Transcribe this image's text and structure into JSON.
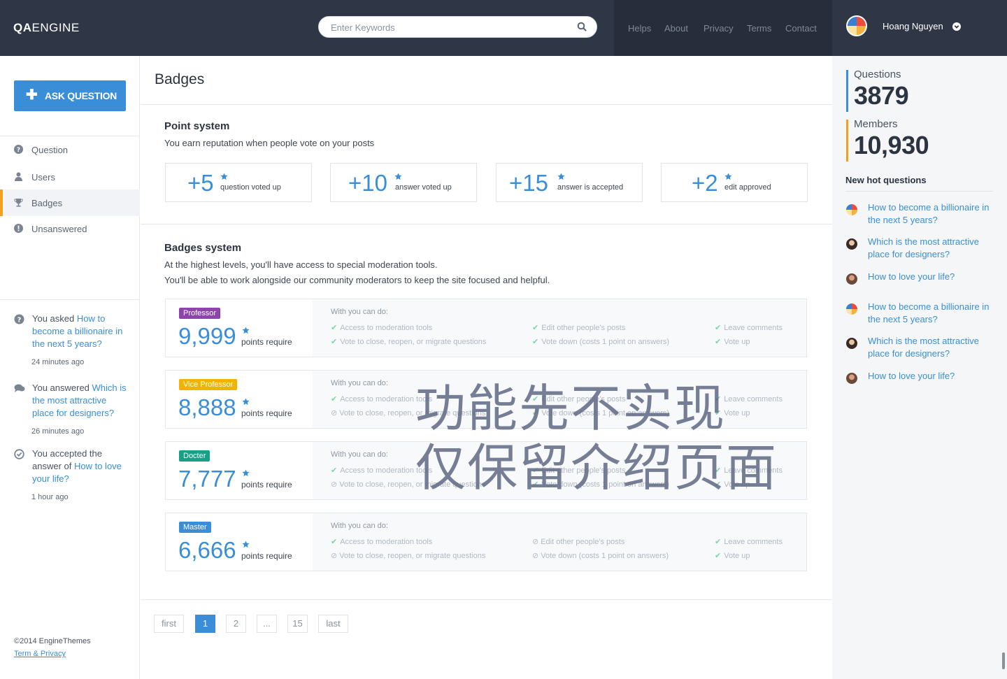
{
  "header": {
    "logo_bold": "QA",
    "logo_rest": "ENGINE",
    "search_placeholder": "Enter Keywords",
    "nav": [
      "Helps",
      "About",
      "Privacy",
      "Terms",
      "Contact"
    ],
    "user_name": "Hoang Nguyen"
  },
  "sidebar": {
    "ask_label": "ASK QUESTION",
    "items": [
      {
        "label": "Question",
        "icon": "question-circle-icon"
      },
      {
        "label": "Users",
        "icon": "user-icon"
      },
      {
        "label": "Badges",
        "icon": "trophy-icon",
        "active": true
      },
      {
        "label": "Unsanswered",
        "icon": "exclamation-circle-icon"
      }
    ],
    "activity": [
      {
        "icon": "question-circle-icon",
        "prefix": "You asked ",
        "link": "How to become a billionaire in the next 5 years?",
        "time": "24 minutes ago"
      },
      {
        "icon": "comments-icon",
        "prefix": "You answered ",
        "link": "Which is the most attractive place for designers?",
        "time": "26 minutes ago"
      },
      {
        "icon": "check-circle-icon",
        "prefix": "You accepted the answer of ",
        "link": "How to love your life?",
        "time": "1 hour ago"
      }
    ],
    "copyright": "©2014 EngineThemes",
    "terms": "Term & Privacy"
  },
  "main": {
    "title": "Badges",
    "point_system": {
      "title": "Point system",
      "desc": "You earn reputation when people vote on your posts",
      "cards": [
        {
          "value": "+5",
          "label": "question voted up"
        },
        {
          "value": "+10",
          "label": "answer voted up"
        },
        {
          "value": "+15",
          "label": "answer is accepted"
        },
        {
          "value": "+2",
          "label": "edit approved"
        }
      ]
    },
    "badges_system": {
      "title": "Badges system",
      "desc1": "At the highest levels, you'll have access to special moderation tools.",
      "desc2": "You'll be able to work alongside our community moderators to keep the site focused and helpful.",
      "with_label": "With you can do:",
      "points_require": "points require",
      "perms": [
        "Access to moderation tools",
        "Vote to close, reopen, or migrate questions",
        "Edit other people's posts",
        "Vote down (costs 1 point on answers)",
        "Leave comments",
        "Vote up"
      ],
      "badges": [
        {
          "name": "Professor",
          "points": "9,999",
          "color": "#8e44ad",
          "enabled": [
            true,
            true,
            true,
            true,
            true,
            true
          ]
        },
        {
          "name": "Vice Professor",
          "points": "8,888",
          "color": "#f0b400",
          "enabled": [
            true,
            false,
            true,
            true,
            true,
            true
          ]
        },
        {
          "name": "Docter",
          "points": "7,777",
          "color": "#16a085",
          "enabled": [
            true,
            false,
            true,
            true,
            true,
            true
          ]
        },
        {
          "name": "Master",
          "points": "6,666",
          "color": "#3a8ed8",
          "enabled": [
            true,
            false,
            false,
            false,
            true,
            true
          ]
        }
      ]
    },
    "overlay": [
      "功能先不实现",
      "仅保留介绍页面"
    ],
    "pagination": [
      "first",
      "1",
      "2",
      "...",
      "15",
      "last"
    ],
    "current_page": "1"
  },
  "right": {
    "questions_label": "Questions",
    "questions_value": "3879",
    "members_label": "Members",
    "members_value": "10,930",
    "hot_title": "New hot questions",
    "hot": [
      "How to become a billionaire in the next 5 years?",
      "Which is the most attractive place for designers?",
      "How to love your life?",
      "How to become a billionaire in the next 5 years?",
      "Which is the most attractive place for designers?",
      "How to love your life?"
    ]
  }
}
